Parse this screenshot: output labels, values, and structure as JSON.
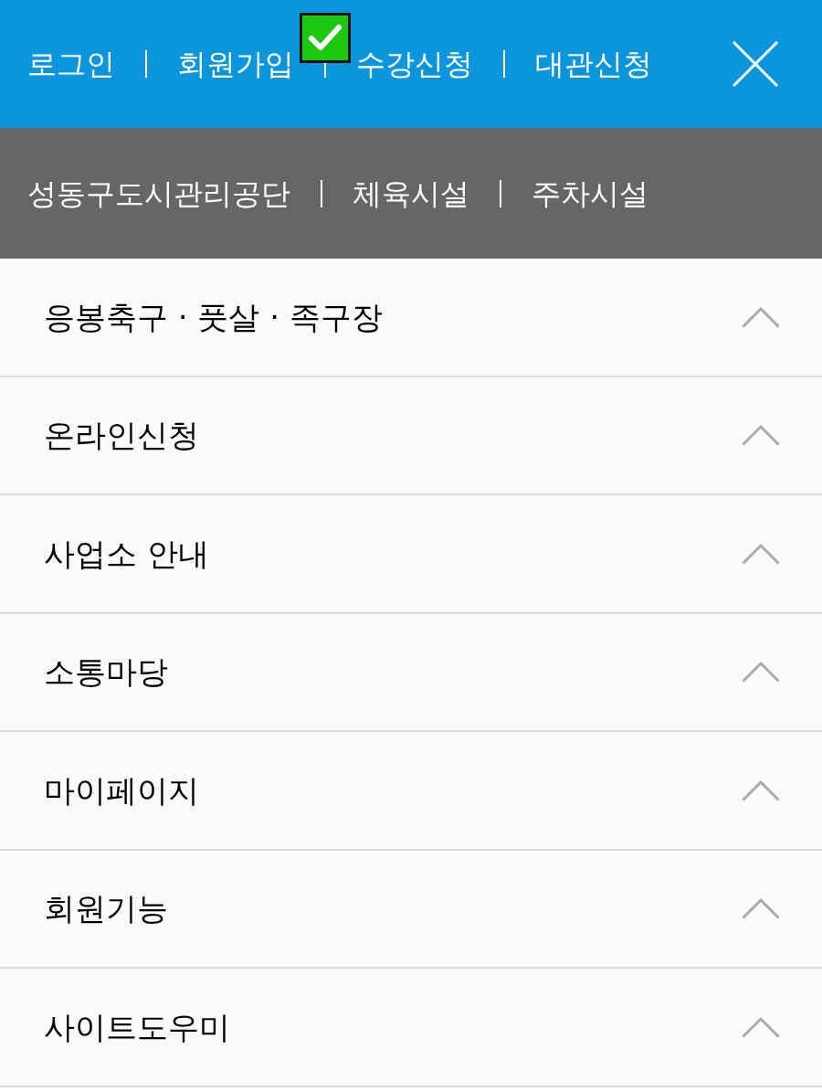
{
  "top_links": [
    "로그인",
    "회원가입",
    "수강신청",
    "대관신청"
  ],
  "site_links": [
    "성동구도시관리공단",
    "체육시설",
    "주차시설"
  ],
  "menu": [
    {
      "label": "응봉축구 · 풋살 · 족구장"
    },
    {
      "label": "온라인신청"
    },
    {
      "label": "사업소 안내"
    },
    {
      "label": "소통마당"
    },
    {
      "label": "마이페이지"
    },
    {
      "label": "회원기능"
    },
    {
      "label": "사이트도우미"
    }
  ]
}
